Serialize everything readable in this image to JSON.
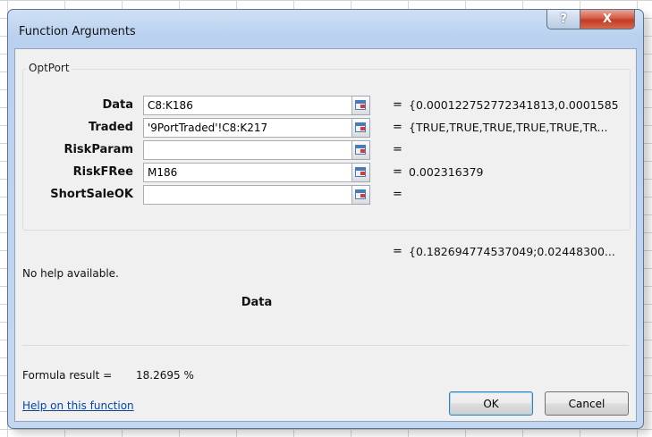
{
  "window": {
    "title": "Function Arguments",
    "help_glyph": "?",
    "close_glyph": "X"
  },
  "function_group": {
    "name": "OptPort",
    "arguments": [
      {
        "label": "Data",
        "value": "C8:K186",
        "result": "{0.000122752772341813,0.0001585"
      },
      {
        "label": "Traded",
        "value": "'9PortTraded'!C8:K217",
        "result": "{TRUE,TRUE,TRUE,TRUE,TRUE,TR..."
      },
      {
        "label": "RiskParam",
        "value": "",
        "result": ""
      },
      {
        "label": "RiskFRee",
        "value": "M186",
        "result": "0.002316379"
      },
      {
        "label": "ShortSaleOK",
        "value": "",
        "result": ""
      }
    ],
    "equals": "="
  },
  "overall_result": "{0.182694774537049;0.02448300...",
  "help_text": "No help available.",
  "current_argument": "Data",
  "formula_result": {
    "label": "Formula result =",
    "value": "18.2695 %"
  },
  "footer": {
    "help_link": "Help on this function",
    "ok_label": "OK",
    "cancel_label": "Cancel"
  }
}
